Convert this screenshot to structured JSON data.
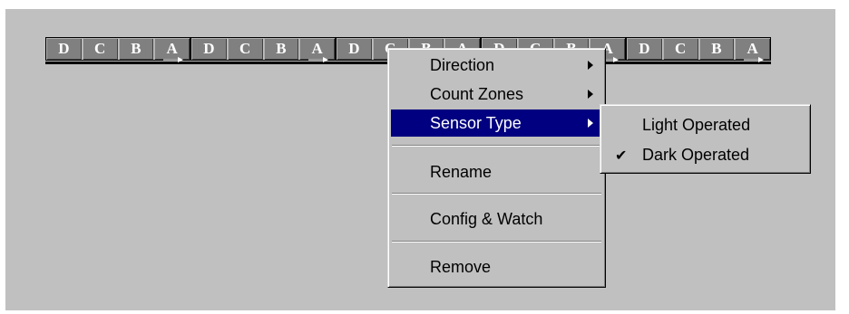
{
  "zones": [
    {
      "cells": [
        "D",
        "C",
        "B",
        "A"
      ]
    },
    {
      "cells": [
        "D",
        "C",
        "B",
        "A"
      ]
    },
    {
      "cells": [
        "D",
        "C",
        "B",
        "A"
      ]
    },
    {
      "cells": [
        "D",
        "C",
        "B",
        "A"
      ]
    },
    {
      "cells": [
        "D",
        "C",
        "B",
        "A"
      ]
    }
  ],
  "context_menu": {
    "items": [
      {
        "label": "Direction",
        "has_submenu": true
      },
      {
        "label": "Count Zones",
        "has_submenu": true
      },
      {
        "label": "Sensor Type",
        "has_submenu": true,
        "selected": true
      },
      {
        "label": "Rename"
      },
      {
        "label": "Config & Watch"
      },
      {
        "label": "Remove"
      }
    ]
  },
  "sensor_type_submenu": {
    "items": [
      {
        "label": "Light Operated",
        "checked": false
      },
      {
        "label": "Dark Operated",
        "checked": true
      }
    ]
  },
  "colors": {
    "menu_highlight": "#000080",
    "face": "#c0c0c0",
    "zone_fill": "#808080"
  }
}
